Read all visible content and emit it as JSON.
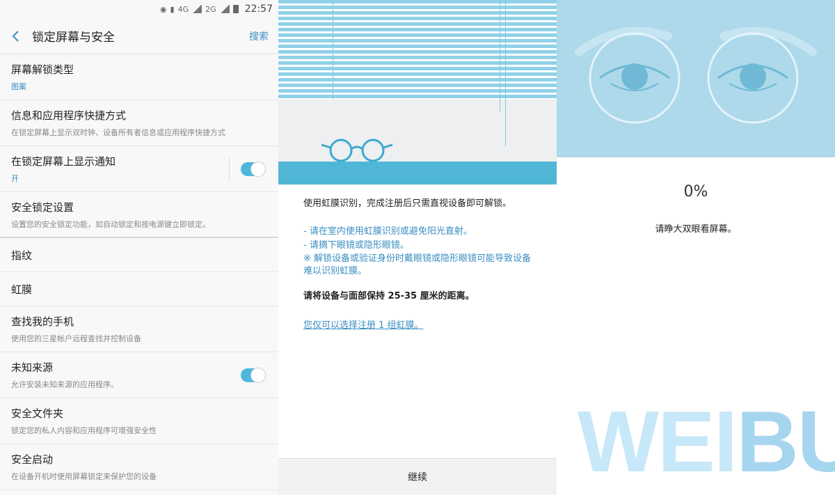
{
  "status_bar": {
    "network": "4G",
    "network2": "2G",
    "time": "22:57"
  },
  "settings": {
    "title": "锁定屏幕与安全",
    "search_label": "搜索",
    "items": [
      {
        "title": "屏幕解锁类型",
        "subtitle": "图案"
      },
      {
        "title": "信息和应用程序快捷方式",
        "subtitle": "在锁定屏幕上显示双时钟、设备所有者信息或应用程序快捷方式"
      },
      {
        "title": "在锁定屏幕上显示通知",
        "subtitle": "开",
        "toggle": true
      },
      {
        "title": "安全锁定设置",
        "subtitle": "设置您的安全锁定功能，如自动锁定和按电源键立即锁定。"
      },
      {
        "title": "指纹"
      },
      {
        "title": "虹膜"
      },
      {
        "title": "查找我的手机",
        "subtitle": "使用您的三星帐户远程查找并控制设备"
      },
      {
        "title": "未知来源",
        "subtitle": "允许安装未知来源的应用程序。",
        "toggle": true
      },
      {
        "title": "安全文件夹",
        "subtitle": "锁定您的私人内容和应用程序可增强安全性"
      },
      {
        "title": "安全启动",
        "subtitle": "在设备开机时使用屏幕锁定来保护您的设备"
      }
    ]
  },
  "iris_intro": {
    "intro": "使用虹膜识别，完成注册后只需直视设备即可解锁。",
    "tips": [
      "- 请在室内使用虹膜识别或避免阳光直射。",
      "- 请摘下眼镜或隐形眼镜。",
      "※ 解锁设备或验证身份时戴眼镜或隐形眼镜可能导致设备难以识别虹膜。"
    ],
    "distance": "请将设备与面部保持 25-35 厘米的距离。",
    "link": "您仅可以选择注册 1 组虹膜。",
    "continue_label": "继续"
  },
  "iris_scan": {
    "progress_text": "0%",
    "progress": 0,
    "hint": "请睁大双眼看屏幕。"
  },
  "watermark": {
    "part1": "WEI",
    "part2": "BUSI"
  },
  "colors": {
    "accent": "#3a8ec2",
    "toggle_on": "#4fb7dd",
    "illustration": "#add9ea"
  }
}
